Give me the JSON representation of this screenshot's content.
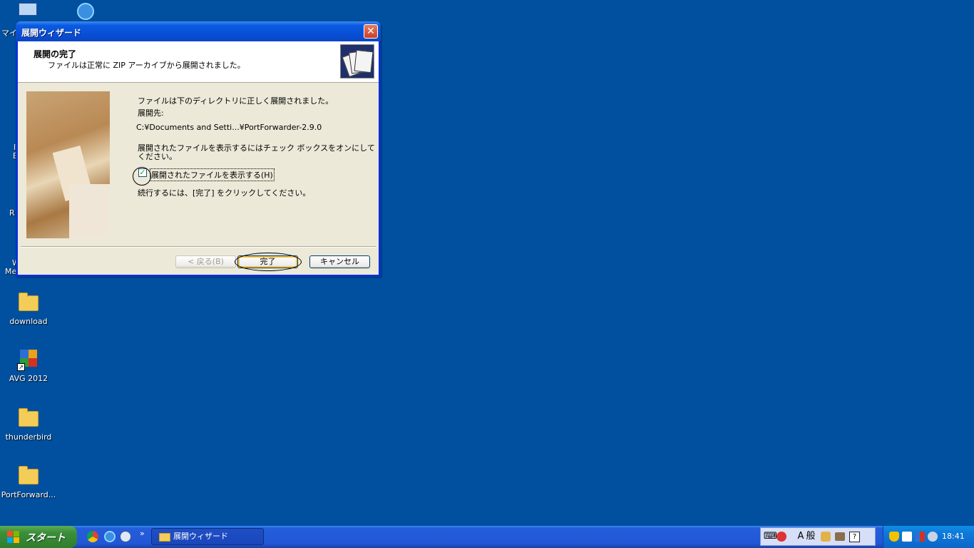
{
  "desktop": {
    "icons": [
      {
        "label": "download"
      },
      {
        "label": "AVG 2012"
      },
      {
        "label": "thunderbird"
      },
      {
        "label": "PortForward..."
      }
    ],
    "partial_labels": [
      "マイ",
      "I",
      "E",
      "R",
      "W",
      "Me"
    ]
  },
  "dialog": {
    "title": "展開ウィザード",
    "close_glyph": "✕",
    "header_title": "展開の完了",
    "header_subtitle": "ファイルは正常に ZIP アーカイブから展開されました。",
    "line1": "ファイルは下のディレクトリに正しく展開されました。",
    "dest_label": "展開先:",
    "dest_path": "C:¥Documents and Setti...¥PortForwarder-2.9.0",
    "instruction_line1": "展開されたファイルを表示するにはチェック ボックスをオンにして",
    "instruction_line2": "ください。",
    "checkbox_label": "展開されたファイルを表示する(H)",
    "checkbox_checked": true,
    "checkmark_glyph": "✓",
    "continue_text": "続行するには、[完了] をクリックしてください。",
    "buttons": {
      "back": "< 戻る(B)",
      "finish": "完了",
      "cancel": "キャンセル"
    }
  },
  "taskbar": {
    "start_label": "スタート",
    "more_glyph": "»",
    "active_task": "展開ウィザード",
    "lang_bar": [
      "⌨",
      "A",
      "般"
    ],
    "clock": "18:41"
  },
  "colors": {
    "desktop": "#00509f",
    "title_bar": "#0a5be0",
    "dialog_face": "#ece9d8",
    "taskbar": "#245edb",
    "start_button": "#3c8f3a",
    "tray": "#0f7ad8"
  }
}
